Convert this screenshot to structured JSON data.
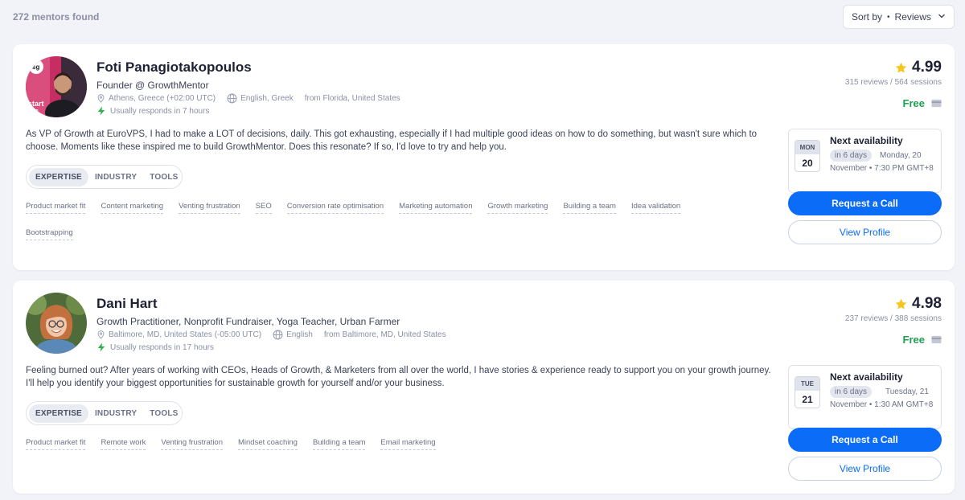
{
  "results": {
    "count_label": "272 mentors found",
    "sort_prefix": "Sort by",
    "sort_value": "Reviews"
  },
  "mentors": [
    {
      "name": "Foti Panagiotakopoulos",
      "title": "Founder @ GrowthMentor",
      "location": "Athens, Greece (+02:00 UTC)",
      "languages": "English, Greek",
      "from": "from Florida, United States",
      "response": "Usually responds in 7 hours",
      "rating": "4.99",
      "reviews": "315 reviews / 564 sessions",
      "price": "Free",
      "bio": "As VP of Growth at EuroVPS, I had to make a LOT of decisions, daily. This got exhausting, especially if I had multiple good ideas on how to do something, but wasn't sure which to choose. Moments like these inspired me to build GrowthMentor. Does this resonate? If so, I'd love to try and help you.",
      "tabs": [
        "EXPERTISE",
        "INDUSTRY",
        "TOOLS"
      ],
      "tags": [
        "Product market fit",
        "Content marketing",
        "Venting frustration",
        "SEO",
        "Conversion rate optimisation",
        "Marketing automation",
        "Growth marketing",
        "Building a team",
        "Idea validation",
        "Bootstrapping"
      ],
      "availability": {
        "heading": "Next availability",
        "cal_dow": "MON",
        "cal_day": "20",
        "pill": "in 6 days",
        "day_text": "Monday, 20",
        "date_text": "November • 7:30 PM GMT+8"
      },
      "request_label": "Request a Call",
      "profile_label": "View Profile",
      "avatar_badge": "sg"
    },
    {
      "name": "Dani Hart",
      "title": "Growth Practitioner, Nonprofit Fundraiser, Yoga Teacher, Urban Farmer",
      "location": "Baltimore, MD, United States (-05:00 UTC)",
      "languages": "English",
      "from": "from Baltimore, MD, United States",
      "response": "Usually responds in 17 hours",
      "rating": "4.98",
      "reviews": "237 reviews / 388 sessions",
      "price": "Free",
      "bio": "Feeling burned out? After years of working with CEOs, Heads of Growth, & Marketers from all over the world, I have stories & experience ready to support you on your growth journey. I'll help you identify your biggest opportunities for sustainable growth for yourself and/or your business.",
      "tabs": [
        "EXPERTISE",
        "INDUSTRY",
        "TOOLS"
      ],
      "tags": [
        "Product market fit",
        "Remote work",
        "Venting frustration",
        "Mindset coaching",
        "Building a team",
        "Email marketing"
      ],
      "availability": {
        "heading": "Next availability",
        "cal_dow": "TUE",
        "cal_day": "21",
        "pill": "in 6 days",
        "day_text": "Tuesday, 21",
        "date_text": "November • 1:30 AM GMT+8"
      },
      "request_label": "Request a Call",
      "profile_label": "View Profile"
    }
  ],
  "colors": {
    "primary": "#0b6cf7",
    "free": "#1e9e52",
    "star": "#f5c518",
    "bolt": "#2bb24c"
  }
}
